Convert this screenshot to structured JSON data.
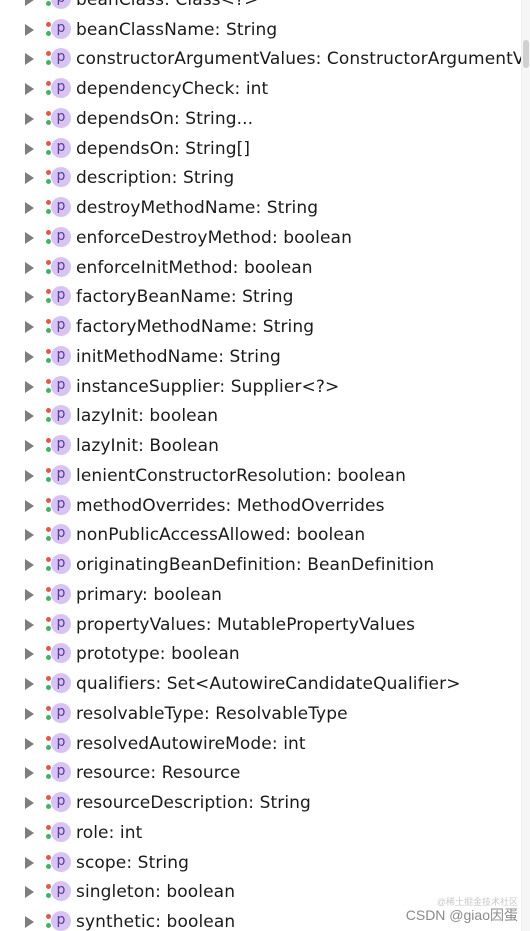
{
  "items": [
    {
      "label": "beanClass: Class<?>"
    },
    {
      "label": "beanClassName: String"
    },
    {
      "label": "constructorArgumentValues: ConstructorArgumentValues"
    },
    {
      "label": "dependencyCheck: int"
    },
    {
      "label": "dependsOn: String..."
    },
    {
      "label": "dependsOn: String[]"
    },
    {
      "label": "description: String"
    },
    {
      "label": "destroyMethodName: String"
    },
    {
      "label": "enforceDestroyMethod: boolean"
    },
    {
      "label": "enforceInitMethod: boolean"
    },
    {
      "label": "factoryBeanName: String"
    },
    {
      "label": "factoryMethodName: String"
    },
    {
      "label": "initMethodName: String"
    },
    {
      "label": "instanceSupplier: Supplier<?>"
    },
    {
      "label": "lazyInit: boolean"
    },
    {
      "label": "lazyInit: Boolean"
    },
    {
      "label": "lenientConstructorResolution: boolean"
    },
    {
      "label": "methodOverrides: MethodOverrides"
    },
    {
      "label": "nonPublicAccessAllowed: boolean"
    },
    {
      "label": "originatingBeanDefinition: BeanDefinition"
    },
    {
      "label": "primary: boolean"
    },
    {
      "label": "propertyValues: MutablePropertyValues"
    },
    {
      "label": "prototype: boolean"
    },
    {
      "label": "qualifiers: Set<AutowireCandidateQualifier>"
    },
    {
      "label": "resolvableType: ResolvableType"
    },
    {
      "label": "resolvedAutowireMode: int"
    },
    {
      "label": "resource: Resource"
    },
    {
      "label": "resourceDescription: String"
    },
    {
      "label": "role: int"
    },
    {
      "label": "scope: String"
    },
    {
      "label": "singleton: boolean"
    },
    {
      "label": "synthetic: boolean"
    }
  ],
  "icon_letter": "p",
  "icon_name": "property-icon",
  "colors": {
    "icon_bg": "#d7c4f3",
    "icon_fg": "#5a3c96",
    "access_red": "#e05a4a",
    "access_green": "#48b064",
    "arrow": "#7e7e7e"
  },
  "watermark": {
    "small": "@稀土掘金技术社区",
    "main": "CSDN @giao因蛋"
  }
}
